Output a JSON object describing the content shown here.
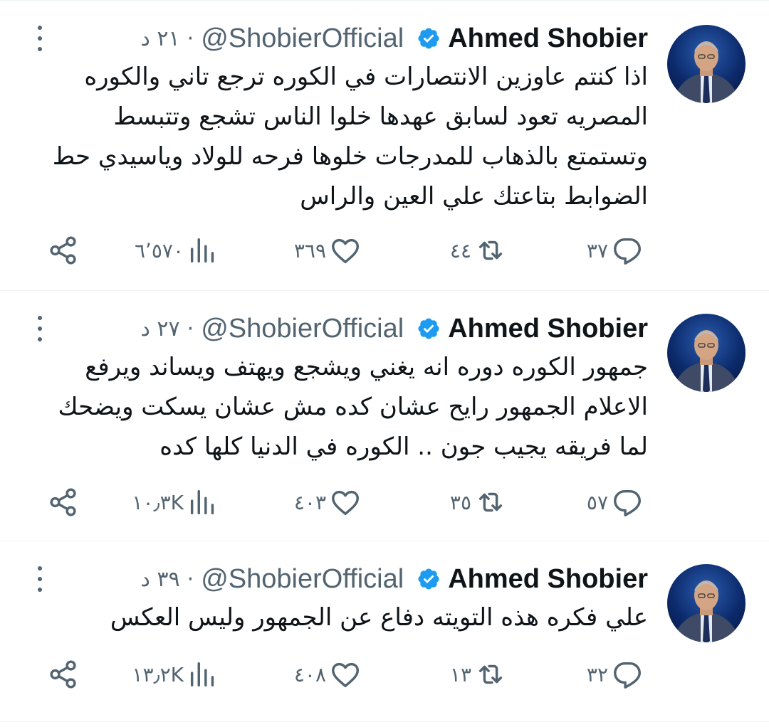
{
  "app": {
    "accent": "#1d9bf0",
    "text_color": "#0f1419",
    "secondary_color": "#536471"
  },
  "tweets": [
    {
      "author_name": "Ahmed Shobier",
      "handle": "@ShobierOfficial",
      "time": "٢١ د",
      "separator": "·",
      "verified": true,
      "text_lines": [
        "اذا كنتم عاوزين الانتصارات في الكوره ترجع تاني والكوره",
        "المصريه تعود لسابق عهدها خلوا الناس تشجع وتتبسط",
        "وتستمتع بالذهاب للمدرجات خلوها فرحه للولاد وياسيدي حط",
        "الضوابط بتاعتك علي العين والراس"
      ],
      "replies": "٣٧",
      "retweets": "٤٤",
      "likes": "٣٦٩",
      "views": "٦٬٥٧٠"
    },
    {
      "author_name": "Ahmed Shobier",
      "handle": "@ShobierOfficial",
      "time": "٢٧ د",
      "separator": "·",
      "verified": true,
      "text_lines": [
        "جمهور الكوره دوره انه يغني ويشجع ويهتف ويساند ويرفع",
        "الاعلام الجمهور رايح عشان كده مش عشان يسكت ويضحك",
        "لما فريقه يجيب جون .. الكوره في الدنيا كلها كده"
      ],
      "replies": "٥٧",
      "retweets": "٣٥",
      "likes": "٤٠٣",
      "views": "١٠٫٣K"
    },
    {
      "author_name": "Ahmed Shobier",
      "handle": "@ShobierOfficial",
      "time": "٣٩ د",
      "separator": "·",
      "verified": true,
      "text_lines": [
        "علي فكره هذه التويته دفاع عن الجمهور  وليس العكس"
      ],
      "replies": "٣٢",
      "retweets": "١٣",
      "likes": "٤٠٨",
      "views": "١٣٫٢K"
    }
  ],
  "icons": {
    "reply": "reply-icon",
    "retweet": "retweet-icon",
    "like": "heart-icon",
    "views": "views-icon",
    "share": "share-icon",
    "more": "more-vertical-icon",
    "verified": "verified-badge-icon"
  }
}
